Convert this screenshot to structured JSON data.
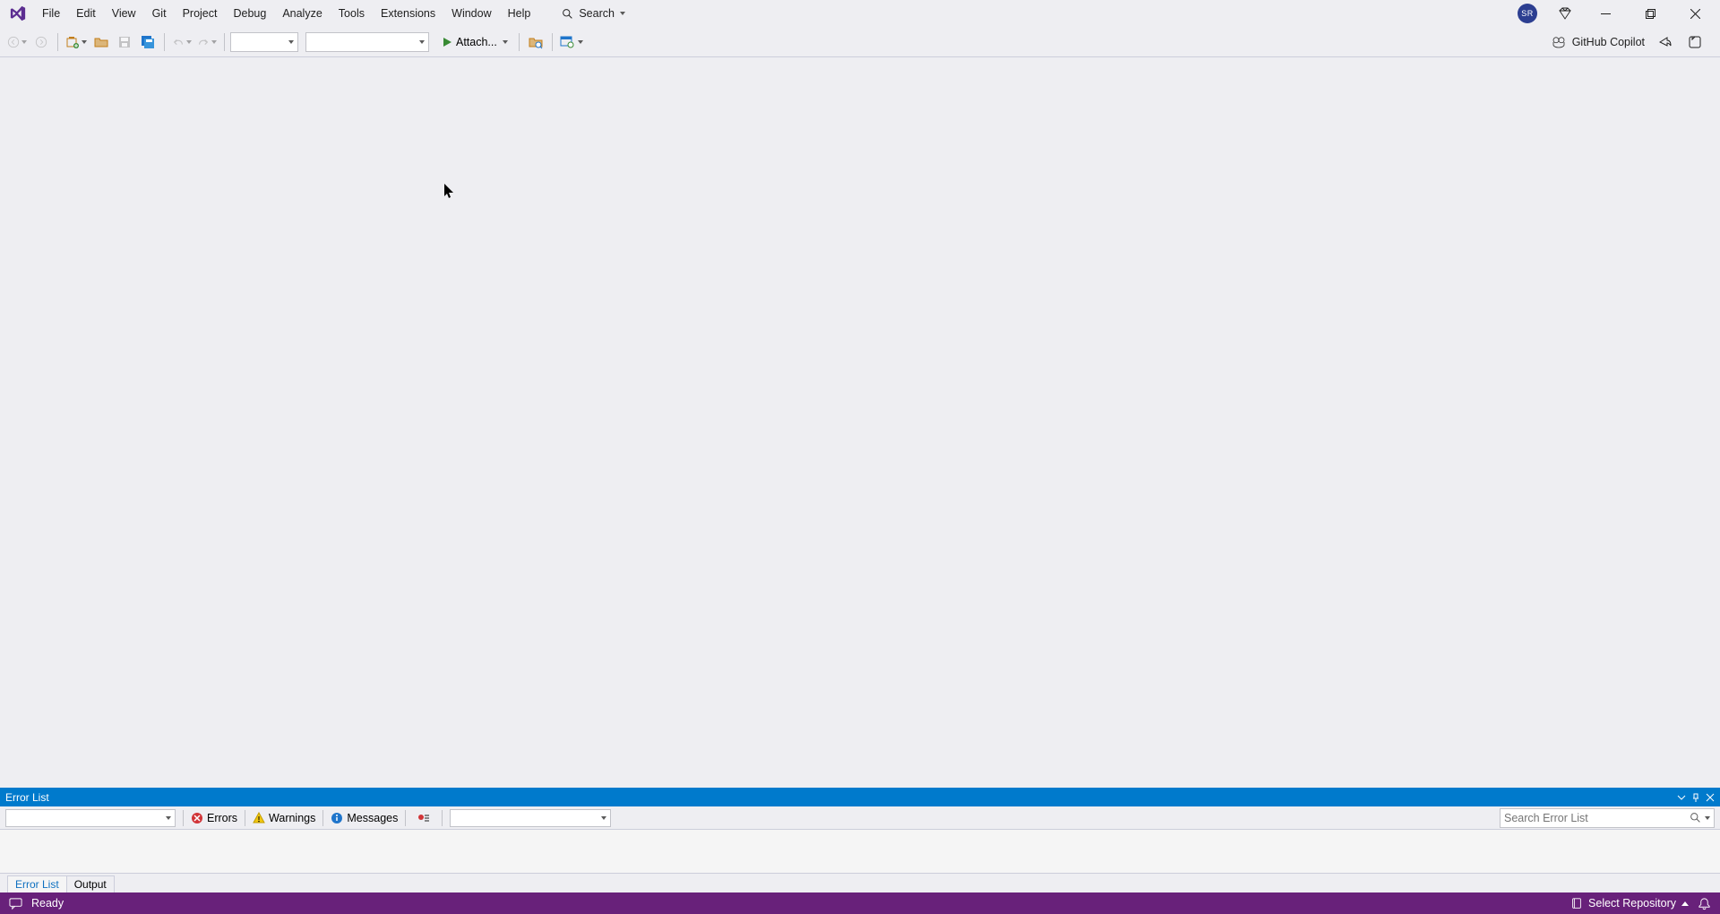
{
  "menu": {
    "items": [
      "File",
      "Edit",
      "View",
      "Git",
      "Project",
      "Debug",
      "Analyze",
      "Tools",
      "Extensions",
      "Window",
      "Help"
    ],
    "search_label": "Search"
  },
  "title_right": {
    "avatar_initials": "SR",
    "copilot_label": "GitHub Copilot"
  },
  "toolbar": {
    "attach_label": "Attach..."
  },
  "error_list": {
    "title": "Error List",
    "errors_label": "Errors",
    "warnings_label": "Warnings",
    "messages_label": "Messages",
    "search_placeholder": "Search Error List"
  },
  "bottom_tabs": {
    "error_list": "Error List",
    "output": "Output"
  },
  "statusbar": {
    "ready": "Ready",
    "select_repo": "Select Repository"
  }
}
